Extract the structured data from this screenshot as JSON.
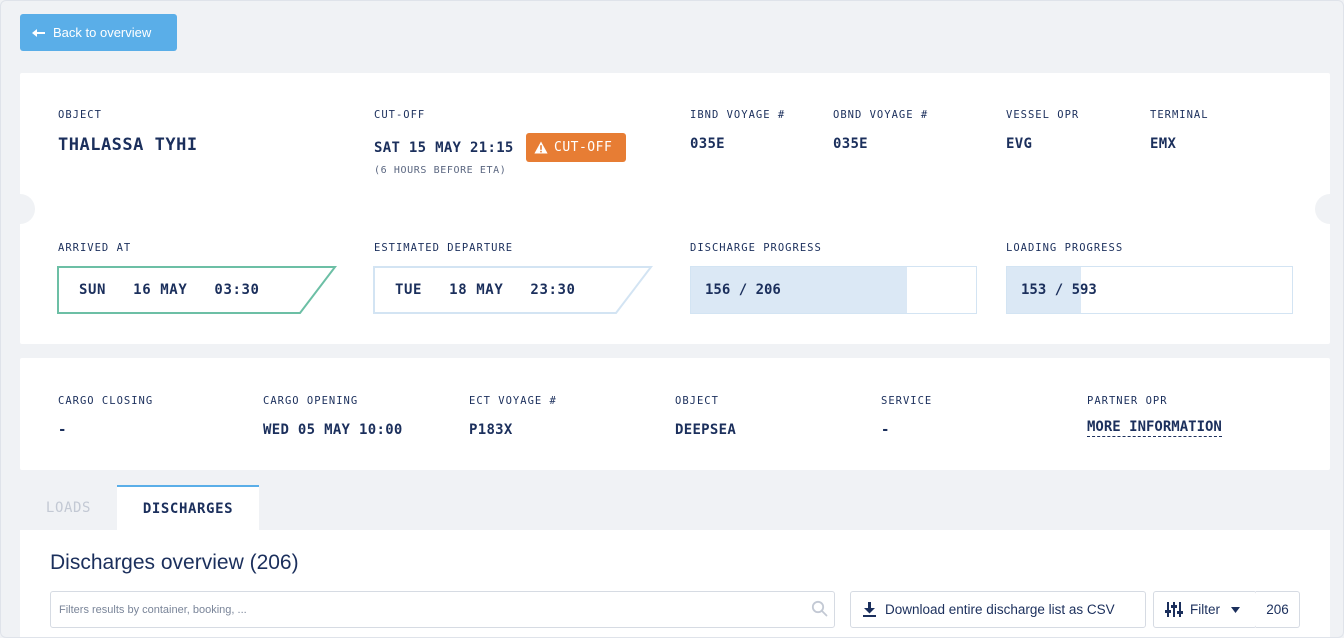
{
  "back_button": {
    "label": "Back to overview"
  },
  "vessel": {
    "object_label": "OBJECT",
    "object_value": "THALASSA TYHI",
    "cutoff_label": "CUT-OFF",
    "cutoff_value": "SAT 15 MAY 21:15",
    "cutoff_badge": "CUT-OFF",
    "cutoff_note": "(6 HOURS BEFORE ETA)",
    "ibnd_label": "IBND VOYAGE #",
    "ibnd_value": "035E",
    "obnd_label": "OBND VOYAGE #",
    "obnd_value": "035E",
    "vessel_opr_label": "VESSEL OPR",
    "vessel_opr_value": "EVG",
    "terminal_label": "TERMINAL",
    "terminal_value": "EMX"
  },
  "schedule": {
    "arrived_label": "ARRIVED AT",
    "arrived_value": "SUN   16 MAY   03:30",
    "departure_label": "ESTIMATED DEPARTURE",
    "departure_value": "TUE   18 MAY   23:30",
    "discharge_label": "DISCHARGE PROGRESS",
    "discharge_text": "156 / 206",
    "discharge_done": 156,
    "discharge_total": 206,
    "loading_label": "LOADING PROGRESS",
    "loading_text": "153 / 593",
    "loading_done": 153,
    "loading_total": 593
  },
  "cargo": {
    "closing_label": "CARGO CLOSING",
    "closing_value": "-",
    "opening_label": "CARGO OPENING",
    "opening_value": "WED 05 MAY 10:00",
    "ect_label": "ECT VOYAGE #",
    "ect_value": "P183X",
    "object_label": "OBJECT",
    "object_value": "DEEPSEA",
    "service_label": "SERVICE",
    "service_value": "-",
    "partner_label": "PARTNER OPR",
    "partner_link": "MORE INFORMATION"
  },
  "tabs": [
    {
      "label": "LOADS",
      "active": false
    },
    {
      "label": "DISCHARGES",
      "active": true
    }
  ],
  "overview": {
    "title": "Discharges overview (206)",
    "search_placeholder": "Filters results by container, booking, ...",
    "csv_button": "Download entire discharge list as CSV",
    "filter_button": "Filter",
    "count": "206"
  },
  "colors": {
    "primary": "#5aaee8",
    "navy": "#1b2f5c",
    "warning": "#e77d34",
    "arrived_border": "#6cbfa5",
    "progress_fill": "#dbe8f5"
  },
  "icons": [
    "arrow-left-icon",
    "warning-icon",
    "search-icon",
    "download-icon",
    "sliders-icon",
    "caret-down-icon"
  ]
}
